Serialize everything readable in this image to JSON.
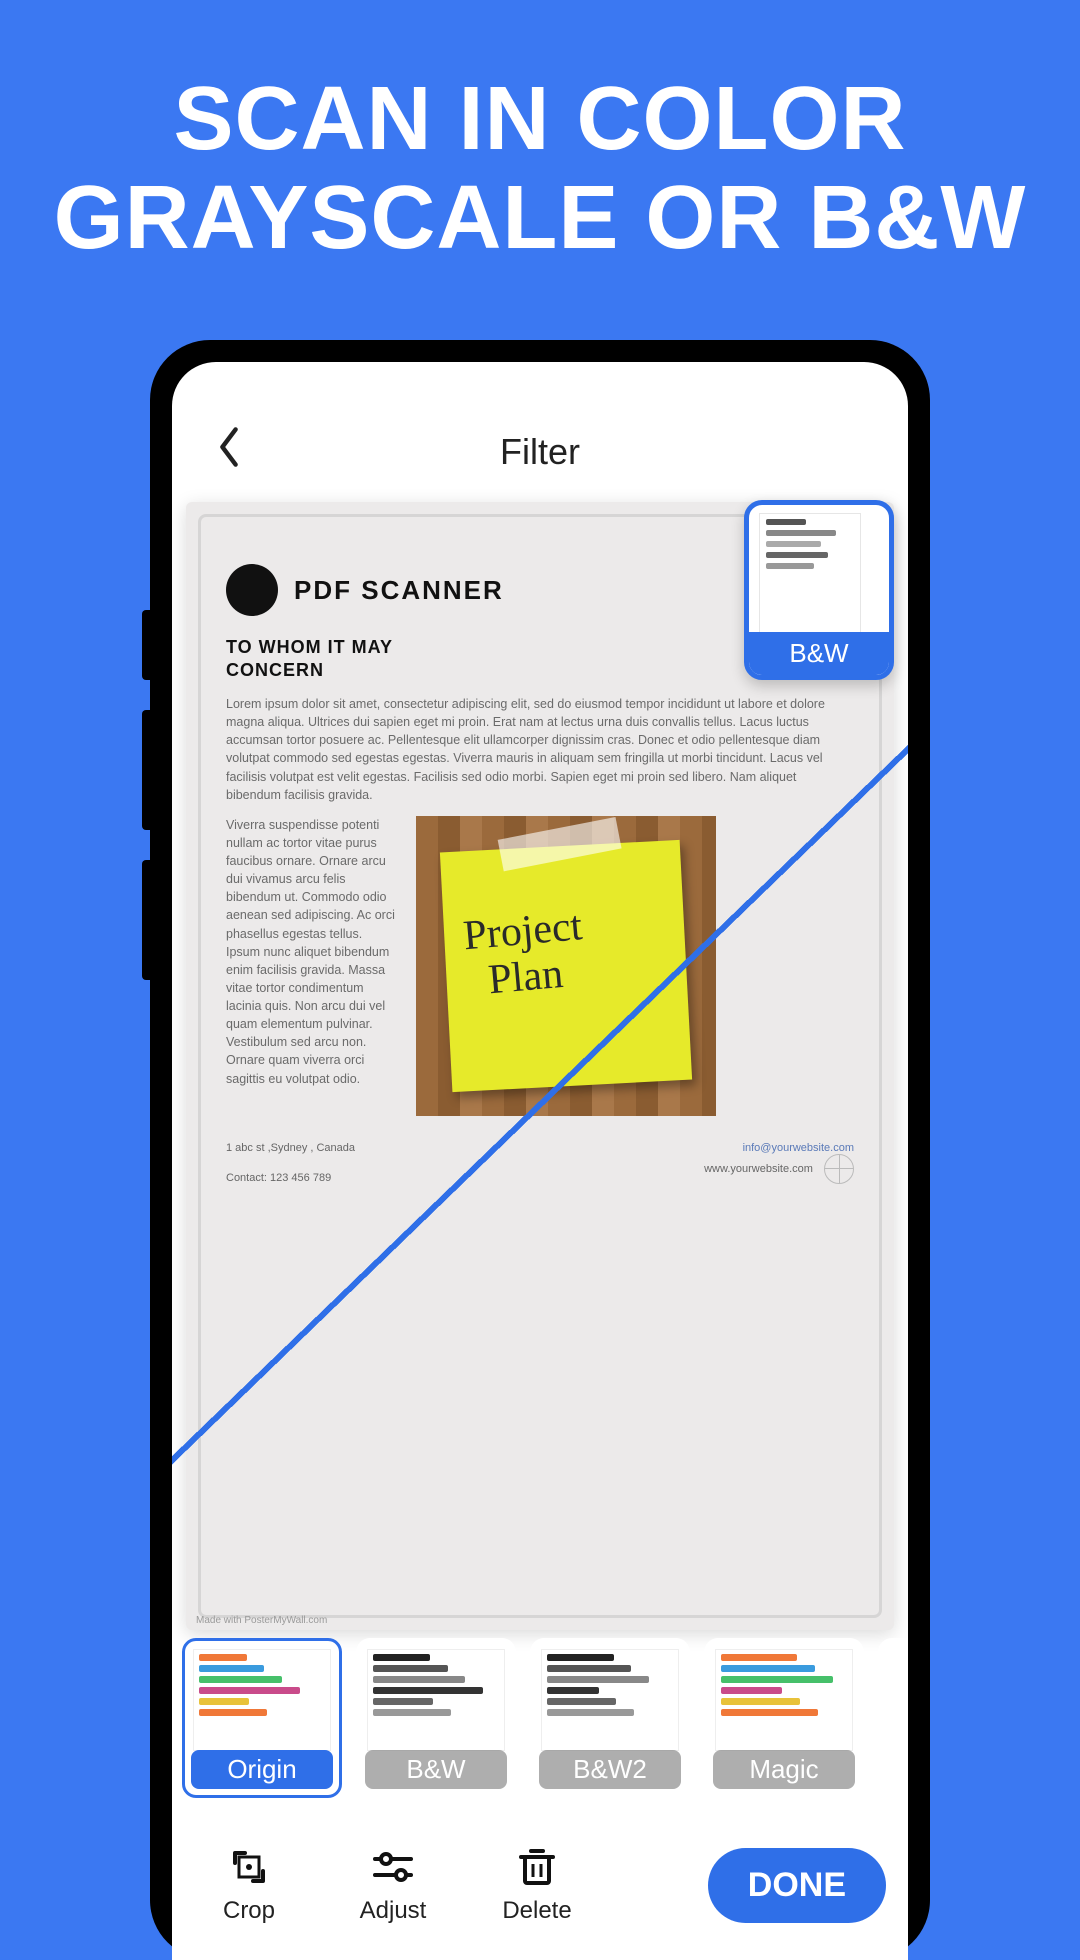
{
  "promo": {
    "line1": "SCAN IN COLOR",
    "line2": "GRAYSCALE OR B&W"
  },
  "topbar": {
    "title": "Filter"
  },
  "document": {
    "brand": "PDF SCANNER",
    "salutation": "TO WHOM IT MAY CONCERN",
    "para1": "Lorem ipsum dolor sit amet, consectetur adipiscing elit, sed do eiusmod tempor incididunt ut labore et dolore magna aliqua. Ultrices dui sapien eget mi proin. Erat nam at lectus urna duis convallis tellus. Lacus luctus accumsan tortor posuere ac. Pellentesque elit ullamcorper dignissim cras. Donec et odio pellentesque diam volutpat commodo sed egestas egestas. Viverra mauris in aliquam sem fringilla ut morbi tincidunt. Lacus vel facilisis volutpat est velit egestas. Facilisis sed odio morbi. Sapien eget mi proin sed libero. Nam aliquet bibendum facilisis gravida.",
    "para2": "Viverra suspendisse potenti nullam ac tortor vitae purus faucibus ornare. Ornare arcu dui vivamus arcu felis bibendum ut. Commodo odio aenean sed adipiscing. Ac orci phasellus egestas tellus. Ipsum nunc aliquet bibendum enim facilisis gravida. Massa vitae tortor condimentum lacinia quis. Non arcu dui vel quam elementum pulvinar. Vestibulum sed arcu non. Ornare quam viverra orci sagittis eu volutpat odio.",
    "sticky_line1": "Project",
    "sticky_line2": "Plan",
    "address": "1 abc st ,Sydney , Canada",
    "contact": "Contact: 123 456 789",
    "email": "info@yourwebsite.com",
    "website": "www.yourwebsite.com",
    "made_with": "Made with PosterMyWall.com"
  },
  "float_chip": {
    "label": "B&W"
  },
  "filters": [
    {
      "label": "Origin",
      "selected": true,
      "style": "color"
    },
    {
      "label": "B&W",
      "selected": false,
      "style": "bw"
    },
    {
      "label": "B&W2",
      "selected": false,
      "style": "bw"
    },
    {
      "label": "Magic",
      "selected": false,
      "style": "color"
    }
  ],
  "toolbar": {
    "crop": "Crop",
    "adjust": "Adjust",
    "delete": "Delete",
    "done": "DONE"
  }
}
